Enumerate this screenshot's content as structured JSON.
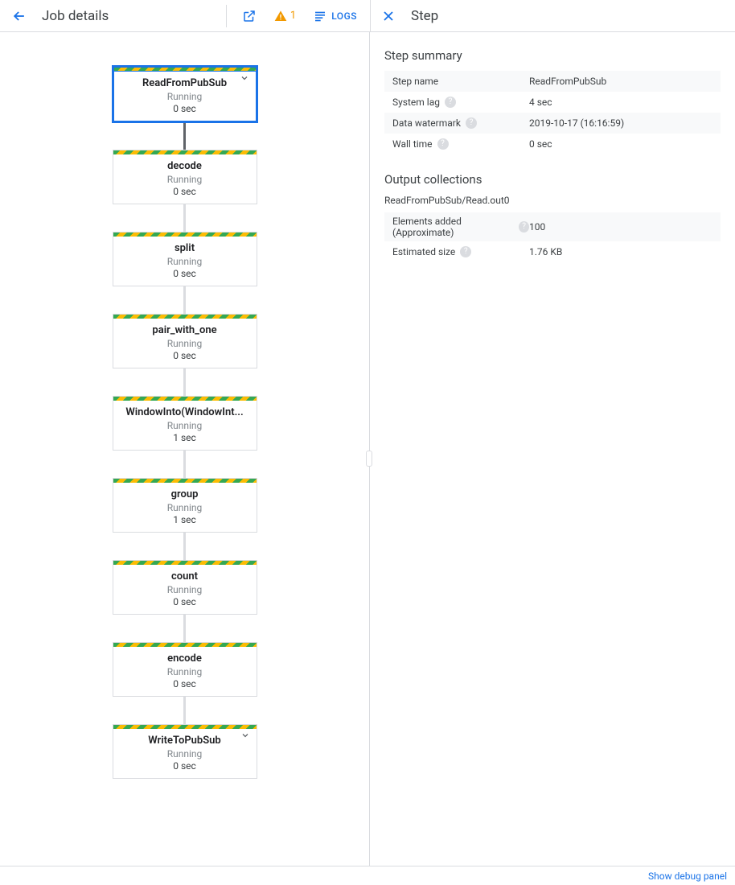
{
  "header": {
    "page_title": "Job details",
    "warning_count": "1",
    "logs_label": "LOGS",
    "step_panel_title": "Step"
  },
  "graph": {
    "nodes": [
      {
        "name": "ReadFromPubSub",
        "status": "Running",
        "time": "0 sec",
        "selected": true,
        "expandable": true,
        "conn_dark": true
      },
      {
        "name": "decode",
        "status": "Running",
        "time": "0 sec"
      },
      {
        "name": "split",
        "status": "Running",
        "time": "0 sec"
      },
      {
        "name": "pair_with_one",
        "status": "Running",
        "time": "0 sec"
      },
      {
        "name": "WindowInto(WindowInt...",
        "status": "Running",
        "time": "1 sec"
      },
      {
        "name": "group",
        "status": "Running",
        "time": "1 sec"
      },
      {
        "name": "count",
        "status": "Running",
        "time": "0 sec"
      },
      {
        "name": "encode",
        "status": "Running",
        "time": "0 sec"
      },
      {
        "name": "WriteToPubSub",
        "status": "Running",
        "time": "0 sec",
        "expandable": true
      }
    ]
  },
  "step": {
    "summary_title": "Step summary",
    "rows": [
      {
        "k": "Step name",
        "v": "ReadFromPubSub",
        "help": false
      },
      {
        "k": "System lag",
        "v": "4 sec",
        "help": true
      },
      {
        "k": "Data watermark",
        "v": "2019-10-17 (16:16:59)",
        "help": true
      },
      {
        "k": "Wall time",
        "v": "0 sec",
        "help": true
      }
    ],
    "output_title": "Output collections",
    "output_name": "ReadFromPubSub/Read.out0",
    "output_rows": [
      {
        "k": "Elements added (Approximate)",
        "v": "100",
        "help": true
      },
      {
        "k": "Estimated size",
        "v": "1.76 KB",
        "help": true
      }
    ]
  },
  "footer": {
    "debug_label": "Show debug panel"
  }
}
